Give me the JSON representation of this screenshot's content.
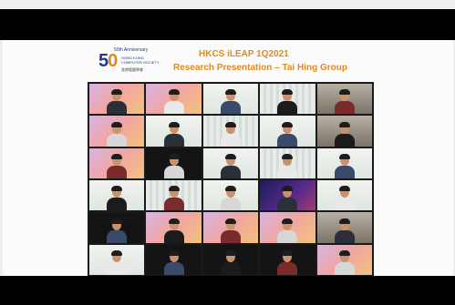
{
  "logo": {
    "anniversary": "50th Anniversary",
    "number": "50",
    "org_lines": [
      "HONG KONG",
      "COMPUTER SOCIETY"
    ],
    "org_chinese": "香港電腦學會"
  },
  "slide": {
    "title": "HKCS iLEAP 1Q2021",
    "subtitle": "Research Presentation – Tai Hing Group"
  },
  "colors": {
    "accent": "#e08a1e",
    "brand": "#1b3b8c"
  }
}
